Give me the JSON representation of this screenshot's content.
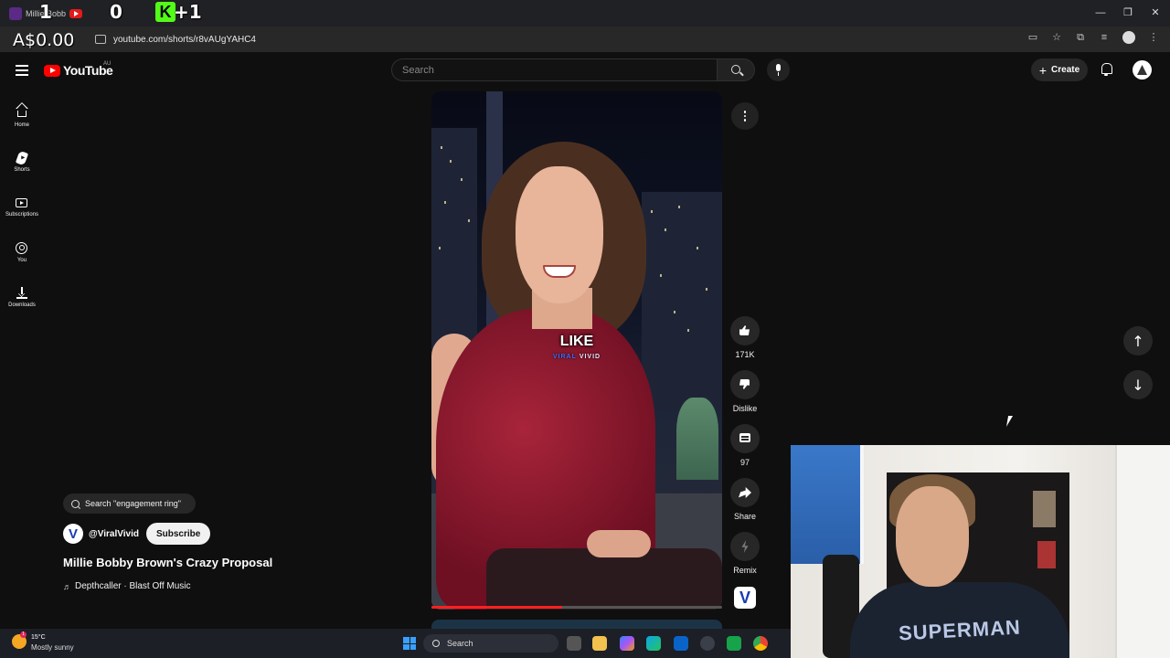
{
  "browser": {
    "tab_title": "Millie Bobb",
    "overlay_left": "1",
    "overlay_mid": "0",
    "overlay_right": "+1",
    "overlay_k": "K",
    "money": "A$0.00",
    "url": "youtube.com/shorts/r8vAUgYAHC4"
  },
  "header": {
    "logo_text": "YouTube",
    "region": "AU",
    "search_placeholder": "Search",
    "create_label": "Create"
  },
  "sidebar": {
    "items": [
      {
        "label": "Home",
        "icon": "home-icon"
      },
      {
        "label": "Shorts",
        "icon": "shorts-icon"
      },
      {
        "label": "Subscriptions",
        "icon": "subscriptions-icon"
      },
      {
        "label": "You",
        "icon": "you-icon"
      },
      {
        "label": "Downloads",
        "icon": "download-icon"
      }
    ]
  },
  "video": {
    "caption": "LIKE",
    "caption_brand_a": "VIRAL",
    "caption_brand_b": " VIVID",
    "progress_fraction": 0.45
  },
  "actions": {
    "like_count": "171K",
    "dislike_label": "Dislike",
    "comment_count": "97",
    "share_label": "Share",
    "remix_label": "Remix"
  },
  "meta": {
    "search_chip": "Search \"engagement ring\"",
    "channel_handle": "@ViralVivid",
    "channel_initial": "V",
    "subscribe_label": "Subscribe",
    "title": "Millie Bobby Brown's Crazy Proposal",
    "music": "Depthcaller · Blast Off Music"
  },
  "webcam": {
    "shirt_text": "SUPERMAN"
  },
  "taskbar": {
    "temperature": "15°C",
    "weather": "Mostly sunny",
    "weather_badge": "1",
    "search_label": "Search"
  },
  "colors": {
    "accent_red": "#ff0000",
    "background": "#0f0f0f",
    "button_bg": "#272727"
  }
}
